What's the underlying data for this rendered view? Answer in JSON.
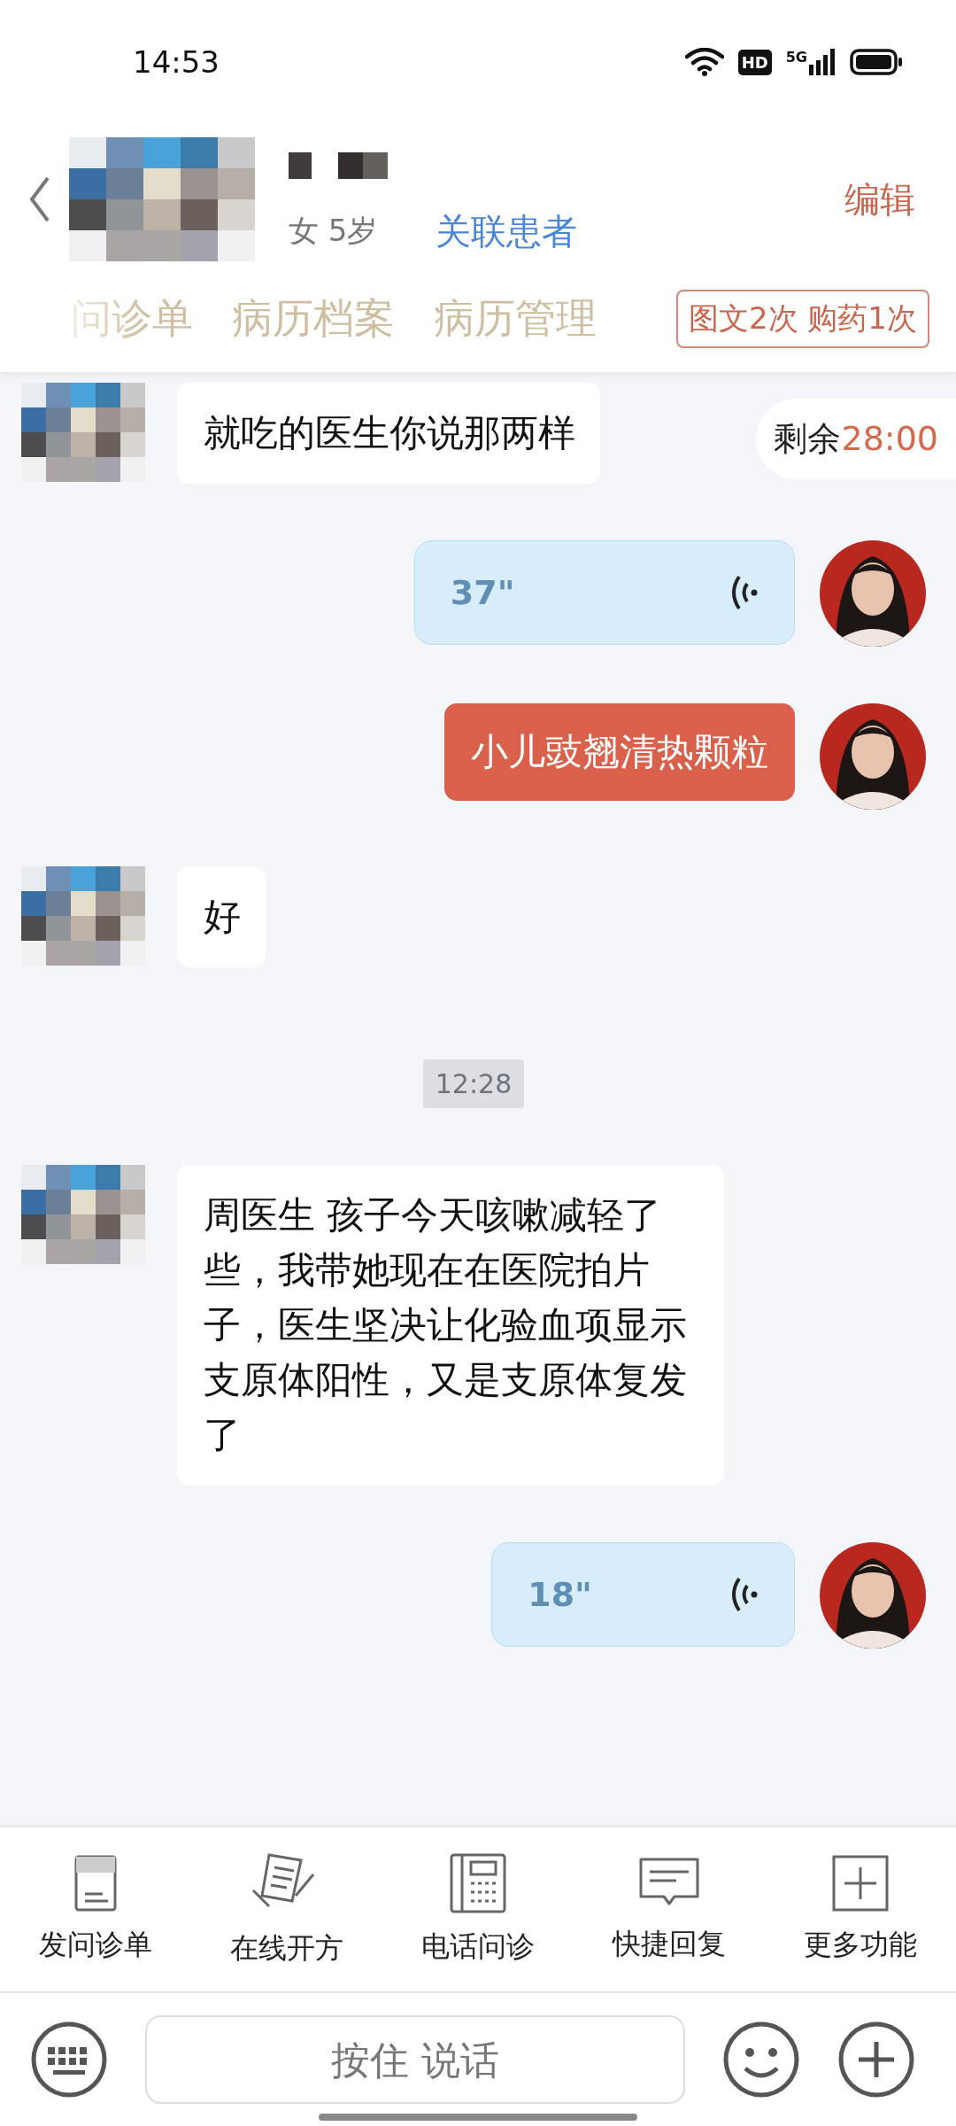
{
  "status_bar": {
    "time": "14:53",
    "hd": "HD",
    "network": "5G"
  },
  "header": {
    "gender_age": "女 5岁",
    "link": "关联患者",
    "edit": "编辑"
  },
  "tabs": [
    {
      "label": "问诊单",
      "selected": false
    },
    {
      "label": "病历档案",
      "selected": false
    },
    {
      "label": "病历管理",
      "selected": false
    }
  ],
  "quota": "图文2次 购药1次",
  "timer": {
    "label": "剩余",
    "value": "28:00"
  },
  "messages": [
    {
      "kind": "text",
      "outgoing": false,
      "text": "就吃的医生你说那两样"
    },
    {
      "kind": "voice",
      "outgoing": true,
      "duration": "37\""
    },
    {
      "kind": "text",
      "outgoing": true,
      "text": "小儿豉翘清热颗粒"
    },
    {
      "kind": "text",
      "outgoing": false,
      "text": "好"
    },
    {
      "kind": "time",
      "text": "12:28"
    },
    {
      "kind": "text",
      "outgoing": false,
      "text": "周医生 孩子今天咳嗽减轻了些，我带她现在在医院拍片子，医生坚决让化验血项显示支原体阳性，又是支原体复发了"
    },
    {
      "kind": "voice",
      "outgoing": true,
      "duration": "18\""
    }
  ],
  "toolbar": [
    {
      "label": "发问诊单",
      "kind": "form"
    },
    {
      "label": "在线开方",
      "kind": "prescription"
    },
    {
      "label": "电话问诊",
      "kind": "phone"
    },
    {
      "label": "快捷回复",
      "kind": "reply"
    },
    {
      "label": "更多功能",
      "kind": "more"
    }
  ],
  "input": {
    "placeholder": "按住 说话"
  }
}
